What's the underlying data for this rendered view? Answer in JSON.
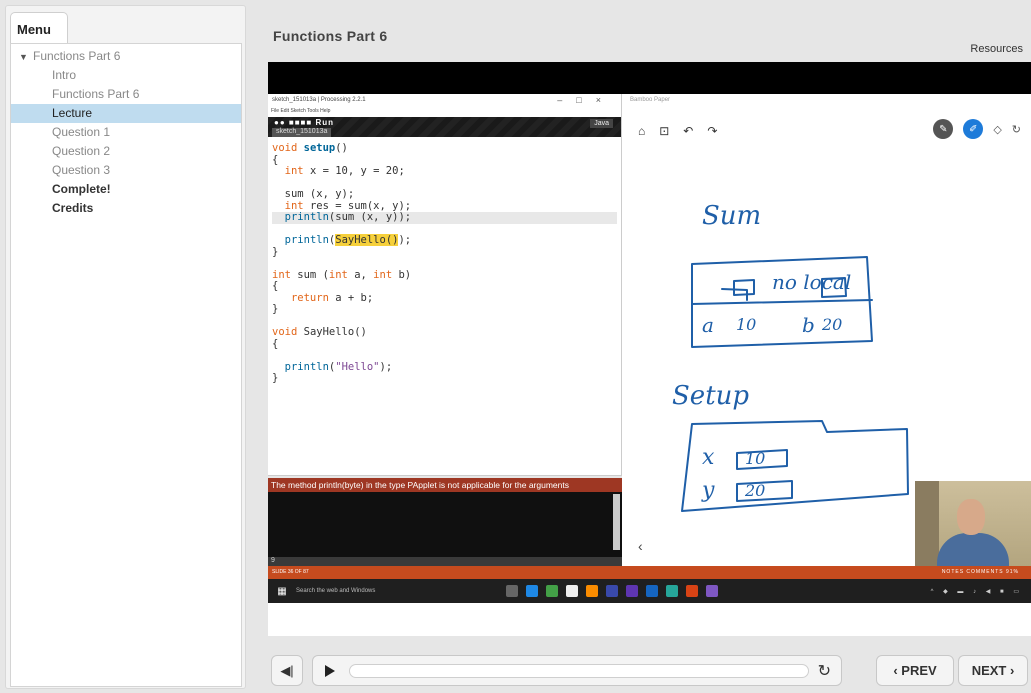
{
  "sidebar": {
    "menu_label": "Menu",
    "items": [
      {
        "label": "Functions Part 6",
        "type": "section"
      },
      {
        "label": "Intro",
        "type": "normal"
      },
      {
        "label": "Functions Part 6",
        "type": "normal"
      },
      {
        "label": "Lecture",
        "type": "active"
      },
      {
        "label": "Question 1",
        "type": "normal"
      },
      {
        "label": "Question 2",
        "type": "normal"
      },
      {
        "label": "Question 3",
        "type": "normal"
      },
      {
        "label": "Complete!",
        "type": "strong"
      },
      {
        "label": "Credits",
        "type": "strong"
      }
    ]
  },
  "header": {
    "title": "Functions Part 6",
    "resources_label": "Resources"
  },
  "video": {
    "ide": {
      "window_title": "sketch_151013a | Processing 2.2.1",
      "menubar": "File  Edit  Sketch  Tools  Help",
      "run_label": "Run",
      "mode_label": "Java",
      "tab_label": "sketch_151013a",
      "error_message": "The method println(byte) in the type PApplet is not applicable for the arguments",
      "status_line": "9"
    },
    "paper": {
      "title": "Bamboo Paper",
      "sketch_words": {
        "sum": "Sum",
        "no_local": "no local",
        "a": "a",
        "a_val": "10",
        "b": "b",
        "b_val": "20",
        "setup": "Setup",
        "x": "x",
        "x_val": "10",
        "y": "y",
        "y_val": "20"
      }
    },
    "slide_bar": {
      "left": "SLIDE 36 OF 87",
      "right": "NOTES   COMMENTS   91%"
    },
    "taskbar": {
      "search": "Search the web and Windows"
    }
  },
  "controls": {
    "progress": 0.0,
    "prev_label": "‹ PREV",
    "next_label": "NEXT ›"
  },
  "colors": {
    "active_menu": "#bfdcef",
    "error_bar": "#9e3723",
    "slide_bar": "#c64b1e",
    "ink": "#1f5fa8"
  }
}
